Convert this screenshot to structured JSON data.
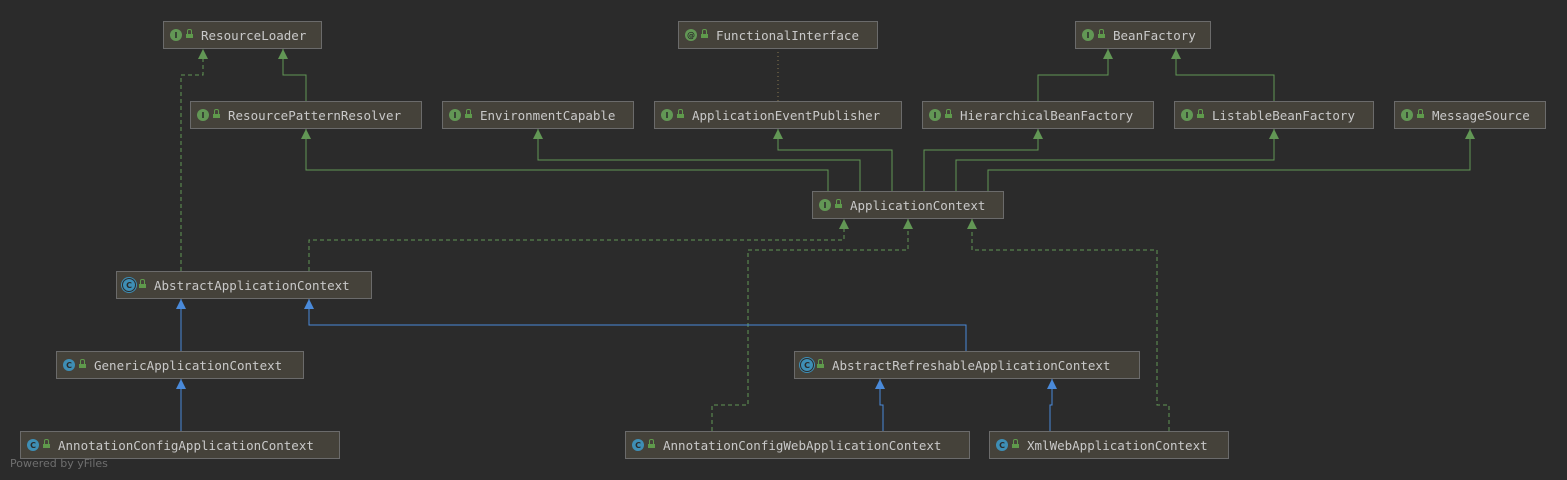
{
  "diagram": {
    "nodes": {
      "resource_loader": {
        "label": "ResourceLoader",
        "kind": "interface",
        "badge": "I"
      },
      "functional_interface": {
        "label": "FunctionalInterface",
        "kind": "annotation",
        "badge": "@"
      },
      "bean_factory": {
        "label": "BeanFactory",
        "kind": "interface",
        "badge": "I"
      },
      "resource_pattern_resolver": {
        "label": "ResourcePatternResolver",
        "kind": "interface",
        "badge": "I"
      },
      "environment_capable": {
        "label": "EnvironmentCapable",
        "kind": "interface",
        "badge": "I"
      },
      "application_event_publisher": {
        "label": "ApplicationEventPublisher",
        "kind": "interface",
        "badge": "I"
      },
      "hierarchical_bean_factory": {
        "label": "HierarchicalBeanFactory",
        "kind": "interface",
        "badge": "I"
      },
      "listable_bean_factory": {
        "label": "ListableBeanFactory",
        "kind": "interface",
        "badge": "I"
      },
      "message_source": {
        "label": "MessageSource",
        "kind": "interface",
        "badge": "I"
      },
      "application_context": {
        "label": "ApplicationContext",
        "kind": "interface",
        "badge": "I"
      },
      "abstract_application_context": {
        "label": "AbstractApplicationContext",
        "kind": "abstract",
        "badge": "C"
      },
      "generic_application_context": {
        "label": "GenericApplicationContext",
        "kind": "class",
        "badge": "C"
      },
      "abstract_refreshable_application_context": {
        "label": "AbstractRefreshableApplicationContext",
        "kind": "abstract",
        "badge": "C"
      },
      "annotation_config_application_context": {
        "label": "AnnotationConfigApplicationContext",
        "kind": "class",
        "badge": "C"
      },
      "annotation_config_web_application_context": {
        "label": "AnnotationConfigWebApplicationContext",
        "kind": "class",
        "badge": "C"
      },
      "xml_web_application_context": {
        "label": "XmlWebApplicationContext",
        "kind": "class",
        "badge": "C"
      }
    },
    "edges": [
      {
        "from": "resource_pattern_resolver",
        "to": "resource_loader",
        "type": "extends-interface"
      },
      {
        "from": "abstract_application_context",
        "to": "resource_loader",
        "type": "implements"
      },
      {
        "from": "application_event_publisher",
        "to": "functional_interface",
        "type": "annotated"
      },
      {
        "from": "hierarchical_bean_factory",
        "to": "bean_factory",
        "type": "extends-interface"
      },
      {
        "from": "listable_bean_factory",
        "to": "bean_factory",
        "type": "extends-interface"
      },
      {
        "from": "application_context",
        "to": "resource_pattern_resolver",
        "type": "extends-interface"
      },
      {
        "from": "application_context",
        "to": "environment_capable",
        "type": "extends-interface"
      },
      {
        "from": "application_context",
        "to": "application_event_publisher",
        "type": "extends-interface"
      },
      {
        "from": "application_context",
        "to": "hierarchical_bean_factory",
        "type": "extends-interface"
      },
      {
        "from": "application_context",
        "to": "listable_bean_factory",
        "type": "extends-interface"
      },
      {
        "from": "application_context",
        "to": "message_source",
        "type": "extends-interface"
      },
      {
        "from": "abstract_application_context",
        "to": "application_context",
        "type": "implements"
      },
      {
        "from": "annotation_config_web_application_context",
        "to": "application_context",
        "type": "implements"
      },
      {
        "from": "xml_web_application_context",
        "to": "application_context",
        "type": "implements"
      },
      {
        "from": "generic_application_context",
        "to": "abstract_application_context",
        "type": "extends-class"
      },
      {
        "from": "abstract_refreshable_application_context",
        "to": "abstract_application_context",
        "type": "extends-class"
      },
      {
        "from": "annotation_config_application_context",
        "to": "generic_application_context",
        "type": "extends-class"
      },
      {
        "from": "annotation_config_web_application_context",
        "to": "abstract_refreshable_application_context",
        "type": "extends-class"
      },
      {
        "from": "xml_web_application_context",
        "to": "abstract_refreshable_application_context",
        "type": "extends-class"
      }
    ],
    "colors": {
      "interface_edge": "#629755",
      "class_edge": "#4a8ad9",
      "annotation_edge": "#8a7a50"
    }
  },
  "watermark": "Powered by yFiles"
}
